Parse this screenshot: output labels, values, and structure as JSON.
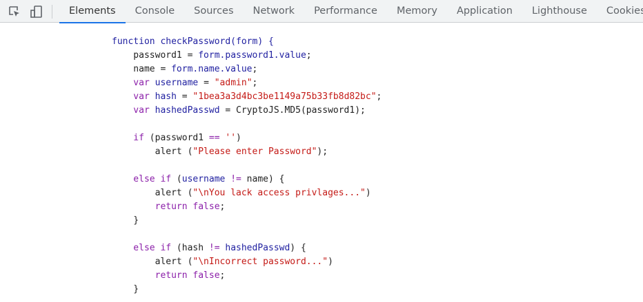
{
  "toolbar": {
    "inspect_icon": "inspect-element-icon",
    "device_icon": "device-toolbar-icon",
    "tabs": [
      {
        "label": "Elements",
        "active": true
      },
      {
        "label": "Console",
        "active": false
      },
      {
        "label": "Sources",
        "active": false
      },
      {
        "label": "Network",
        "active": false
      },
      {
        "label": "Performance",
        "active": false
      },
      {
        "label": "Memory",
        "active": false
      },
      {
        "label": "Application",
        "active": false
      },
      {
        "label": "Lighthouse",
        "active": false
      },
      {
        "label": "Cookies",
        "active": false
      }
    ]
  },
  "code": {
    "lines": [
      [
        [
          "fn",
          "function checkPassword(form) {"
        ]
      ],
      [
        [
          "",
          "    password1 = "
        ],
        [
          "prop",
          "form.password1.value"
        ],
        [
          "",
          ";"
        ]
      ],
      [
        [
          "",
          "    name = "
        ],
        [
          "prop",
          "form.name.value"
        ],
        [
          "",
          ";"
        ]
      ],
      [
        [
          "kw",
          "    var "
        ],
        [
          "prop",
          "username"
        ],
        [
          "",
          " = "
        ],
        [
          "str",
          "\"admin\""
        ],
        [
          "",
          ";"
        ]
      ],
      [
        [
          "kw",
          "    var "
        ],
        [
          "prop",
          "hash"
        ],
        [
          "",
          " = "
        ],
        [
          "str",
          "\"1bea3a3d4bc3be1149a75b33fb8d82bc\""
        ],
        [
          "",
          ";"
        ]
      ],
      [
        [
          "kw",
          "    var "
        ],
        [
          "prop",
          "hashedPasswd"
        ],
        [
          "",
          " = CryptoJS.MD5(password1);"
        ]
      ],
      [
        [
          "",
          ""
        ]
      ],
      [
        [
          "kw",
          "    if "
        ],
        [
          "",
          "(password1 "
        ],
        [
          "kw",
          "=="
        ],
        [
          "",
          " "
        ],
        [
          "str",
          "''"
        ],
        [
          "",
          ")"
        ]
      ],
      [
        [
          "",
          "        alert ("
        ],
        [
          "str",
          "\"Please enter Password\""
        ],
        [
          "",
          ");"
        ]
      ],
      [
        [
          "",
          ""
        ]
      ],
      [
        [
          "kw",
          "    else if "
        ],
        [
          "",
          "("
        ],
        [
          "prop",
          "username"
        ],
        [
          "",
          " "
        ],
        [
          "kw",
          "!="
        ],
        [
          "",
          " name) {"
        ]
      ],
      [
        [
          "",
          "        alert ("
        ],
        [
          "str",
          "\"\\nYou lack access privlages...\""
        ],
        [
          "",
          ")"
        ]
      ],
      [
        [
          "kw",
          "        return false"
        ],
        [
          "",
          ";"
        ]
      ],
      [
        [
          "",
          "    }"
        ]
      ],
      [
        [
          "",
          ""
        ]
      ],
      [
        [
          "kw",
          "    else if "
        ],
        [
          "",
          "(hash "
        ],
        [
          "kw",
          "!="
        ],
        [
          "",
          " "
        ],
        [
          "prop",
          "hashedPasswd"
        ],
        [
          "",
          ") {"
        ]
      ],
      [
        [
          "",
          "        alert ("
        ],
        [
          "str",
          "\"\\nIncorrect password...\""
        ],
        [
          "",
          ")"
        ]
      ],
      [
        [
          "kw",
          "        return false"
        ],
        [
          "",
          ";"
        ]
      ],
      [
        [
          "",
          "    }"
        ]
      ]
    ]
  }
}
